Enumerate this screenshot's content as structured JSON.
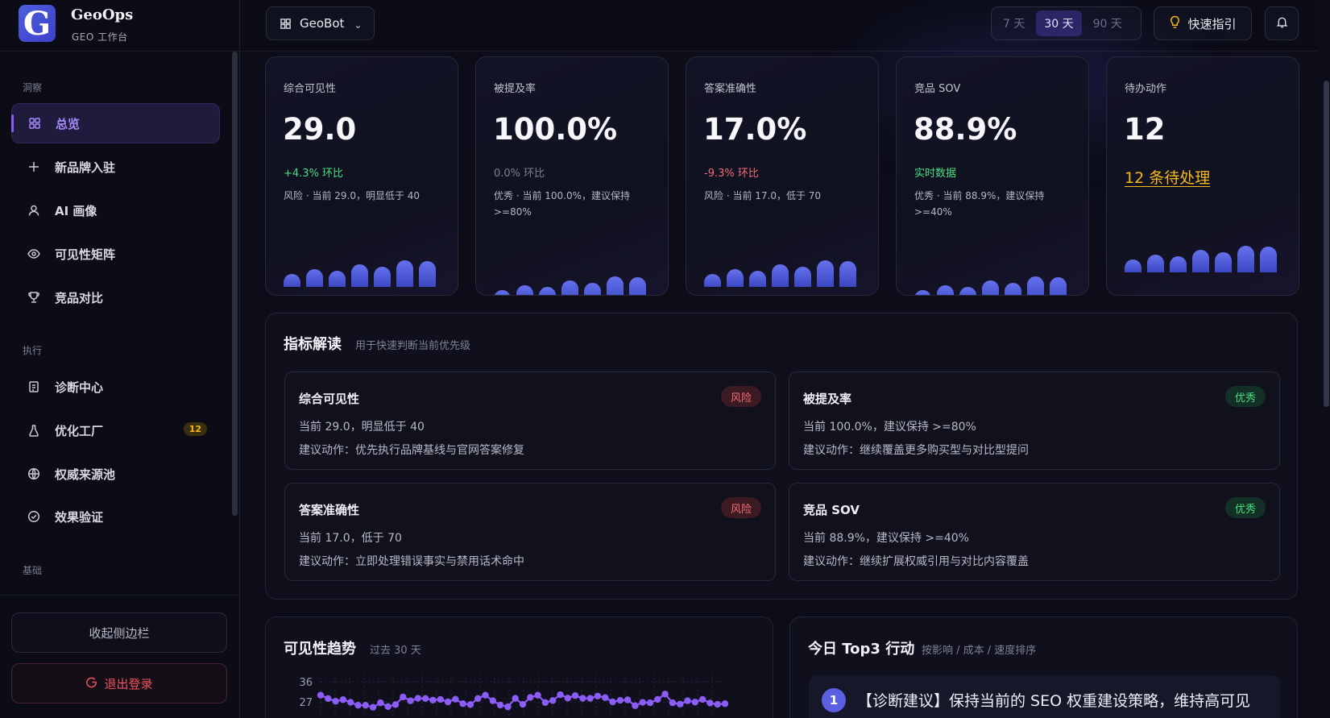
{
  "brand": {
    "logo_letter": "G",
    "name": "GeoOps",
    "subtitle": "GEO 工作台"
  },
  "sidebar": {
    "sections": [
      {
        "label": "洞察"
      },
      {
        "label": "执行"
      },
      {
        "label": "基础"
      }
    ],
    "items": [
      {
        "label": "总览",
        "icon": "grid-icon",
        "active": true
      },
      {
        "label": "新品牌入驻",
        "icon": "plus-icon"
      },
      {
        "label": "AI 画像",
        "icon": "user-icon"
      },
      {
        "label": "可见性矩阵",
        "icon": "eye-icon"
      },
      {
        "label": "竞品对比",
        "icon": "trophy-icon"
      },
      {
        "label": "诊断中心",
        "icon": "clipboard-icon"
      },
      {
        "label": "优化工厂",
        "icon": "flask-icon",
        "badge": "12"
      },
      {
        "label": "权威来源池",
        "icon": "globe-icon"
      },
      {
        "label": "效果验证",
        "icon": "check-circle-icon"
      }
    ],
    "collapse_label": "收起侧边栏",
    "logout_label": "退出登录"
  },
  "topbar": {
    "project": "GeoBot",
    "ranges": [
      {
        "label": "7 天"
      },
      {
        "label": "30 天",
        "selected": true
      },
      {
        "label": "90 天"
      }
    ],
    "quick_guide": "快速指引"
  },
  "kpis": [
    {
      "title": "综合可见性",
      "value": "29.0",
      "delta": "+4.3% 环比",
      "delta_color": "#4ade80",
      "note": "风险 · 当前 29.0，明显低于 40",
      "bars": [
        0.45,
        0.62,
        0.55,
        0.78,
        0.7,
        0.92,
        0.9
      ]
    },
    {
      "title": "被提及率",
      "value": "100.0%",
      "delta": "0.0% 环比",
      "delta_color": "#7d7f90",
      "note": "优秀 · 当前 100.0%，建议保持 >=80%",
      "bars": [
        0.45,
        0.62,
        0.55,
        0.78,
        0.7,
        0.92,
        0.9
      ]
    },
    {
      "title": "答案准确性",
      "value": "17.0%",
      "delta": "-9.3% 环比",
      "delta_color": "#f36b75",
      "note": "风险 · 当前 17.0，低于 70",
      "bars": [
        0.45,
        0.62,
        0.55,
        0.78,
        0.7,
        0.92,
        0.9
      ]
    },
    {
      "title": "竞品 SOV",
      "value": "88.9%",
      "delta": "实时数据",
      "delta_color": "#4ade80",
      "note": "优秀 · 当前 88.9%，建议保持 >=40%",
      "bars": [
        0.45,
        0.62,
        0.55,
        0.78,
        0.7,
        0.92,
        0.9
      ]
    },
    {
      "title": "待办动作",
      "value": "12",
      "link": "12 条待处理",
      "bars": [
        0.45,
        0.62,
        0.55,
        0.78,
        0.7,
        0.92,
        0.9
      ]
    }
  ],
  "insights": {
    "title": "指标解读",
    "subtitle": "用于快速判断当前优先级",
    "cards": [
      {
        "name": "综合可见性",
        "tag": "风险",
        "tag_type": "risk",
        "line1": "当前 29.0，明显低于 40",
        "line2": "建议动作：优先执行品牌基线与官网答案修复"
      },
      {
        "name": "被提及率",
        "tag": "优秀",
        "tag_type": "good",
        "line1": "当前 100.0%，建议保持 >=80%",
        "line2": "建议动作：继续覆盖更多购买型与对比型提问"
      },
      {
        "name": "答案准确性",
        "tag": "风险",
        "tag_type": "risk",
        "line1": "当前 17.0，低于 70",
        "line2": "建议动作：立即处理错误事实与禁用话术命中"
      },
      {
        "name": "竞品 SOV",
        "tag": "优秀",
        "tag_type": "good",
        "line1": "当前 88.9%，建议保持 >=40%",
        "line2": "建议动作：继续扩展权威引用与对比内容覆盖"
      }
    ]
  },
  "trend": {
    "title": "可见性趋势",
    "subtitle": "过去 30 天",
    "chart_data": {
      "type": "line",
      "title": "可见性趋势",
      "x": [
        1,
        2,
        3,
        4,
        5,
        6,
        7,
        8,
        9,
        10,
        11,
        12,
        13,
        14,
        15,
        16,
        17,
        18,
        19,
        20,
        21,
        22,
        23,
        24,
        25,
        26,
        27,
        28,
        29,
        30,
        31,
        32,
        33,
        34,
        35,
        36,
        37,
        38,
        39,
        40,
        41,
        42,
        43,
        44,
        45,
        46,
        47,
        48,
        49,
        50,
        51,
        52,
        53,
        54,
        55
      ],
      "values": [
        30,
        28.5,
        27.3,
        28,
        26.8,
        25.5,
        25.5,
        24.6,
        26.6,
        24.9,
        25.8,
        29.2,
        27.5,
        28.6,
        28.5,
        27.8,
        28.1,
        27,
        28.2,
        26.2,
        25.8,
        28.5,
        30,
        27.5,
        25.6,
        24.8,
        28.6,
        25.9,
        29,
        30,
        26.7,
        27.6,
        30.2,
        28.7,
        29.8,
        28.6,
        28.6,
        29.6,
        28.9,
        27,
        27.7,
        27.9,
        25.3,
        26.8,
        26.6,
        28.1,
        30.5,
        26.6,
        26,
        27.5,
        26.9,
        28.1,
        26.5,
        25.9,
        26.2
      ],
      "yticks": [
        "36",
        "27"
      ],
      "ylim": [
        18,
        38
      ],
      "grid": true,
      "color": "#8b5cf6"
    }
  },
  "top3": {
    "title": "今日 Top3 行动",
    "subtitle": "按影响 / 成本 / 速度排序",
    "actions": [
      {
        "num": "1",
        "text": "【诊断建议】保持当前的 SEO 权重建设策略，维持高可见"
      }
    ]
  }
}
